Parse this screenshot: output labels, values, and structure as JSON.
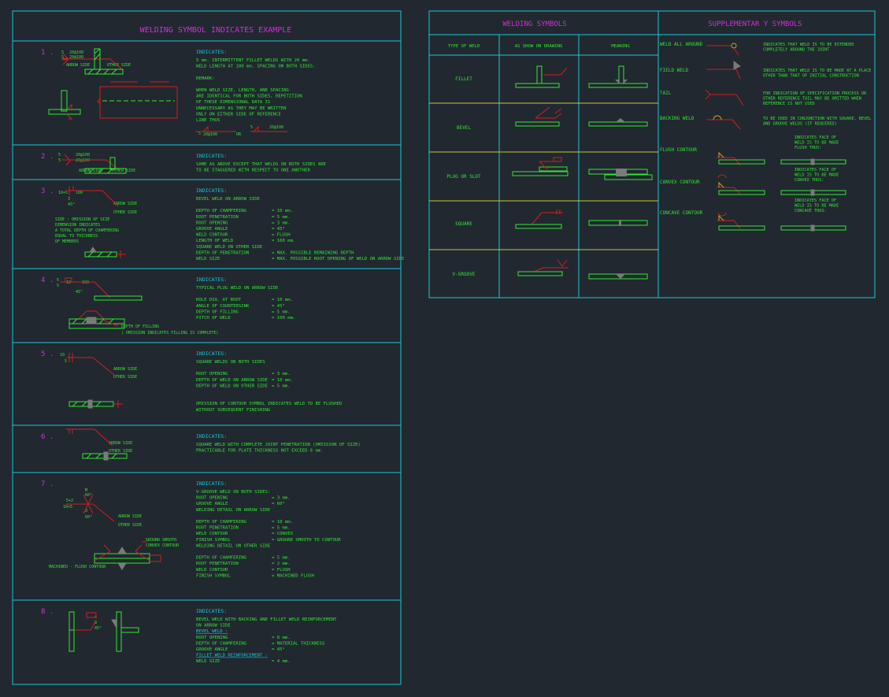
{
  "colors": {
    "background": "#212830",
    "border": "#19c7d6",
    "title": "#d22fd6",
    "text": "#32e632",
    "heading": "#19c7d6",
    "symbol": "#d21e1e",
    "weld": "#7a7a7a",
    "divider": "#c8c832"
  },
  "left": {
    "title": "WELDING SYMBOL INDICATES EXAMPLE",
    "examples": [
      {
        "num": "1 .",
        "heading": "INDICATES:",
        "lines": [
          "5 mm. INTERMITTENT FILLET WELDS WITH 20 mm.",
          "WELD LENGTH AT 100 mm. SPACING ON BOTH SIDES.",
          "",
          "REMARK:",
          "",
          "WHEN WELD SIZE, LENGTH, AND SPACING",
          "ARE IDENTICAL FOR BOTH SIDES, REPETITION",
          "OF THESE DIMENSIONAL DATA IS",
          "UNNECESSARY AS THEY MAY BE WRITTEN",
          "ONLY ON EITHER SIDE OF REFERENCE",
          "LINE THUS"
        ],
        "labels": [
          "5",
          "20@100",
          "5",
          "20@100",
          "ARROW SIDE",
          "OTHER SIDE",
          "20@100",
          "OR",
          "20@100",
          "5",
          "5"
        ]
      },
      {
        "num": "2 .",
        "heading": "INDICATES:",
        "lines": [
          "SAME AS ABOVE EXCEPT THAT WELDS ON BOTH SIDES ARE",
          "TO BE STAGGERED WITH RESPECT TO ONE ANOTHER"
        ],
        "labels": [
          "5",
          "20@100",
          "5",
          "20@100",
          "ARROW SIDE",
          "OTHER SIDE"
        ]
      },
      {
        "num": "3 .",
        "heading": "INDICATES:",
        "lines": [
          "BEVEL WELD ON ARROW SIDE",
          "",
          "DEPTH OF CHAMFERING",
          "ROOT PENETRATION",
          "ROOT OPENING",
          "GROOVE ANGLE",
          "WELD CONTOUR",
          "LENGTH OF WELD",
          "SQUARE WELD ON OTHER SIDE",
          "DEPTH OF PENETRATION",
          "WELD SIZE"
        ],
        "values": [
          "",
          "",
          "= 10 mm.",
          "= 5 mm.",
          "= 3 mm.",
          "= 45°",
          "= FLUSH",
          "= 100 mm.",
          "",
          "= MAX. POSSIBLE REMAINING DEPTH",
          "= MAX. POSSIBLE ROOT OPENING OF WELD ON ARROW SIDE"
        ],
        "labels": [
          "10+5",
          "100",
          "3",
          "45°",
          "ARROW SIDE",
          "OTHER SIDE",
          "SIDE : OMISSION OF SIZE",
          "DIMENSION INDICATES",
          "A TOTAL DEPTH OF CHAMFERING",
          "EQUAL TO THICKNESS",
          "OF MEMBERS"
        ]
      },
      {
        "num": "4 .",
        "heading": "INDICATES:",
        "lines": [
          "TYPICAL PLUG WELD ON ARROW SIDE",
          "",
          "HOLE DIA. AT ROOT",
          "ANGLE OF COUNTERSINK",
          "DEPTH OF FILLING",
          "PITCH OF WELD"
        ],
        "values": [
          "",
          "",
          "= 10 mm.",
          "= 45°",
          "= 5 mm.",
          "= 100 mm."
        ],
        "labels": [
          "5",
          "10",
          "5",
          "100",
          "45°",
          "DEPTH OF FILLING",
          "( OMISSION INDICATES FILLING IS COMPLETE)"
        ]
      },
      {
        "num": "5 .",
        "heading": "INDICATES:",
        "lines": [
          "SQUARE WELDS ON BOTH SIDES",
          "",
          "ROOT OPENING",
          "DEPTH OF WELD ON ARROW SIDE",
          "DEPTH OF WELD ON OTHER SIDE",
          "",
          "",
          "OMISSION OF CONTOUR SYMBOL INDICATES WELD TO BE FLUSHED",
          "WITHOUT SUBSEQUENT FINISHING"
        ],
        "values": [
          "",
          "",
          "= 3 mm.",
          "= 10 mm.",
          "= 5 mm.",
          "",
          "",
          "",
          ""
        ],
        "labels": [
          "10",
          "5",
          "ARROW SIDE",
          "OTHER SIDE"
        ]
      },
      {
        "num": "6 .",
        "heading": "INDICATES:",
        "lines": [
          "SQUARE WELD WITH COMPLETE JOINT PENETRATION (OMISSION OF SIZE)",
          "PRACTICABLE FOR PLATE THICKNESS NOT EXCEED 6 mm."
        ],
        "labels": [
          "ARROW SIDE",
          "OTHER SIDE"
        ]
      },
      {
        "num": "7 .",
        "heading": "INDICATES:",
        "lines": [
          "V-GROOVE WELD ON BOTH SIDES:",
          "ROOT OPENING",
          "GROOVE ANGLE",
          "WELDING DETAIL ON ARROW SIDE",
          "",
          "DEPTH OF CHAMFERING",
          "ROOT PENETRATION",
          "WELD CONTOUR",
          "FINISH SYMBOL",
          "WELDING DETAIL ON OTHER SIDE",
          "",
          "DEPTH OF CHAMFERING",
          "ROOT PENETRATION",
          "WELD CONTOUR",
          "FINISH SYMBOL"
        ],
        "values": [
          "",
          "= 3 mm.",
          "= 60°",
          "",
          "",
          "= 10 mm.",
          "= 5 mm.",
          "= CONVEX",
          "= GROUND SMOOTH TO CONTOUR",
          "",
          "",
          "= 5 mm.",
          "= 2 mm.",
          "= FLUSH",
          "= MACHINED FLUSH"
        ],
        "labels": [
          "5+2",
          "10+5",
          "M",
          "60°",
          "3",
          "60°",
          "ARROW SIDE",
          "OTHER SIDE",
          "GROUND SMOOTH",
          "CONVEX CONTOUR",
          "MACHINED - FLUSH CONTOUR"
        ]
      },
      {
        "num": "8 .",
        "heading": "INDICATES:",
        "lines": [
          "BEVEL WELD WITH BACKING AND FILLET WELD REINFORCEMENT",
          "ON ARROW SIDE",
          "BEVEL WELD :",
          "ROOT OPENING",
          "DEPTH OF CHAMFERING",
          "GROOVE ANGLE",
          "FILLET WELD REINFORCEMENT :",
          "WELD SIZE"
        ],
        "values": [
          "",
          "",
          "",
          "= 8 mm.",
          "= MATERIAL THICKNESS",
          "= 45°",
          "",
          "= 4 mm."
        ],
        "labels": [
          "4",
          "8",
          "45°"
        ]
      }
    ]
  },
  "welding_symbols": {
    "title": "WELDING   SYMBOLS",
    "headers": [
      "TYPE OF WELD",
      "AS SHOW ON DRAWING",
      "MEANING"
    ],
    "rows": [
      "FILLET",
      "BEVEL",
      "PLUG OR SLOT",
      "SQUARE",
      "V-GROOVE"
    ]
  },
  "supplementary": {
    "title": "SUPPLEMENTAR Y     SYMBOLS",
    "items": [
      {
        "name": "WELD ALL AROUND",
        "desc": [
          "INDICATES THAT WELD IS TO BE EXTENDED",
          "COMPLETELY AROUND THE JOINT"
        ]
      },
      {
        "name": "FIELD WELD",
        "desc": [
          "INDICATES THAT WELD IS TO BE MADE AT A PLACE",
          "OTHER THAN THAT OF INITIAL CONSTRUCTION"
        ]
      },
      {
        "name": "TAIL",
        "desc": [
          "FOR INDICATION OF SPECIFICATION PROCESS OR",
          "OTHER REFERENCE TAIL MAY BE OMITTED WHEN",
          "REFERENCE IS NOT USED"
        ]
      },
      {
        "name": "BACKING WELD",
        "desc": [
          "TO BE USED IN CONJUNCTION WITH SQUARE, BEVEL",
          "AND GROOVE WELDS (IF REQUIRED)"
        ]
      },
      {
        "name": "FLUSH CONTOUR",
        "desc": [
          "INDICATES FACE OF",
          "WELD IS TO BE MADE",
          "FLUSH THUS:"
        ]
      },
      {
        "name": "CONVEX CONTOUR",
        "desc": [
          "INDICATES FACE OF",
          "WELD IS TO BE MADE",
          "CONVEX THUS:"
        ]
      },
      {
        "name": "CONCAVE CONTOUR",
        "desc": [
          "INDICATES FACE OF",
          "WELD IS TO BE MADE",
          "CONCAVE THUS:"
        ]
      }
    ]
  }
}
